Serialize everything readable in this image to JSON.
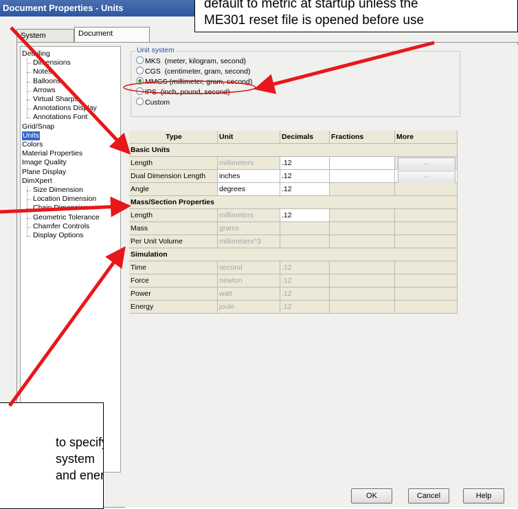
{
  "window": {
    "title": "Document Properties - Units"
  },
  "tabs": [
    {
      "label": "System Options"
    },
    {
      "label": "Document Properties"
    }
  ],
  "tree": {
    "items": [
      {
        "label": "Detailing",
        "level": 0
      },
      {
        "label": "Dimensions",
        "level": 1
      },
      {
        "label": "Notes",
        "level": 1
      },
      {
        "label": "Balloons",
        "level": 1
      },
      {
        "label": "Arrows",
        "level": 1
      },
      {
        "label": "Virtual Sharps",
        "level": 1
      },
      {
        "label": "Annotations Display",
        "level": 1
      },
      {
        "label": "Annotations Font",
        "level": 1
      },
      {
        "label": "Grid/Snap",
        "level": 0
      },
      {
        "label": "Units",
        "level": 0,
        "selected": true
      },
      {
        "label": "Colors",
        "level": 0
      },
      {
        "label": "Material Properties",
        "level": 0
      },
      {
        "label": "Image Quality",
        "level": 0
      },
      {
        "label": "Plane Display",
        "level": 0
      },
      {
        "label": "DimXpert",
        "level": 0
      },
      {
        "label": "Size Dimension",
        "level": 1
      },
      {
        "label": "Location Dimension",
        "level": 1
      },
      {
        "label": "Chain Dimension",
        "level": 1
      },
      {
        "label": "Geometric Tolerance",
        "level": 1
      },
      {
        "label": "Chamfer Controls",
        "level": 1
      },
      {
        "label": "Display Options",
        "level": 1
      }
    ]
  },
  "unit_system": {
    "label": "Unit system",
    "options": [
      {
        "label": "MKS  (meter, kilogram, second)",
        "selected": false
      },
      {
        "label": "CGS  (centimeter, gram, second)",
        "selected": false
      },
      {
        "label": "MMGS (millimeter, gram, second)",
        "selected": true
      },
      {
        "label": "IPS  (inch, pound, second)",
        "selected": false
      },
      {
        "label": "Custom",
        "selected": false
      }
    ]
  },
  "table": {
    "headers": [
      "Type",
      "Unit",
      "Decimals",
      "Fractions",
      "More"
    ],
    "sections": [
      {
        "title": "Basic Units",
        "rows": [
          {
            "type": "Length",
            "unit": "millimeters",
            "decimals": ".12",
            "fractions": "",
            "more": "...",
            "unit_active": false
          },
          {
            "type": "Dual Dimension Length",
            "unit": "inches",
            "decimals": ".12",
            "fractions": "",
            "more": "...",
            "unit_active": true
          },
          {
            "type": "Angle",
            "unit": "degrees",
            "decimals": ".12",
            "fractions": "",
            "more": "",
            "unit_active": true
          }
        ]
      },
      {
        "title": "Mass/Section Properties",
        "rows": [
          {
            "type": "Length",
            "unit": "millimeters",
            "decimals": ".12",
            "fractions": "",
            "more": "",
            "unit_active": false
          },
          {
            "type": "Mass",
            "unit": "grams",
            "decimals": "",
            "fractions": "",
            "more": "",
            "unit_active": false
          },
          {
            "type": "Per Unit Volume",
            "unit": "millimeters^3",
            "decimals": "",
            "fractions": "",
            "more": "",
            "unit_active": false
          }
        ]
      },
      {
        "title": "Simulation",
        "rows": [
          {
            "type": "Time",
            "unit": "second",
            "decimals": ".12",
            "fractions": "",
            "more": "",
            "unit_active": false
          },
          {
            "type": "Force",
            "unit": "newton",
            "decimals": ".12",
            "fractions": "",
            "more": "",
            "unit_active": false
          },
          {
            "type": "Power",
            "unit": "watt",
            "decimals": ".12",
            "fractions": "",
            "more": "",
            "unit_active": false
          },
          {
            "type": "Energy",
            "unit": "joule",
            "decimals": ".12",
            "fractions": "",
            "more": "",
            "unit_active": false
          }
        ]
      }
    ]
  },
  "buttons": {
    "ok": "OK",
    "cancel": "Cancel",
    "help": "Help"
  },
  "callouts": {
    "top_line1": "default to metric at startup unless the",
    "top_line2": "ME301 reset file is opened before use",
    "bottom_line1": "to specify",
    "bottom_line2": "system",
    "bottom_line3": "and energy"
  },
  "colors": {
    "arrow": "#e8171b",
    "highlight_ellipse": "#d01010",
    "selection": "#3366cc",
    "title_bar": "#2e56a0"
  }
}
